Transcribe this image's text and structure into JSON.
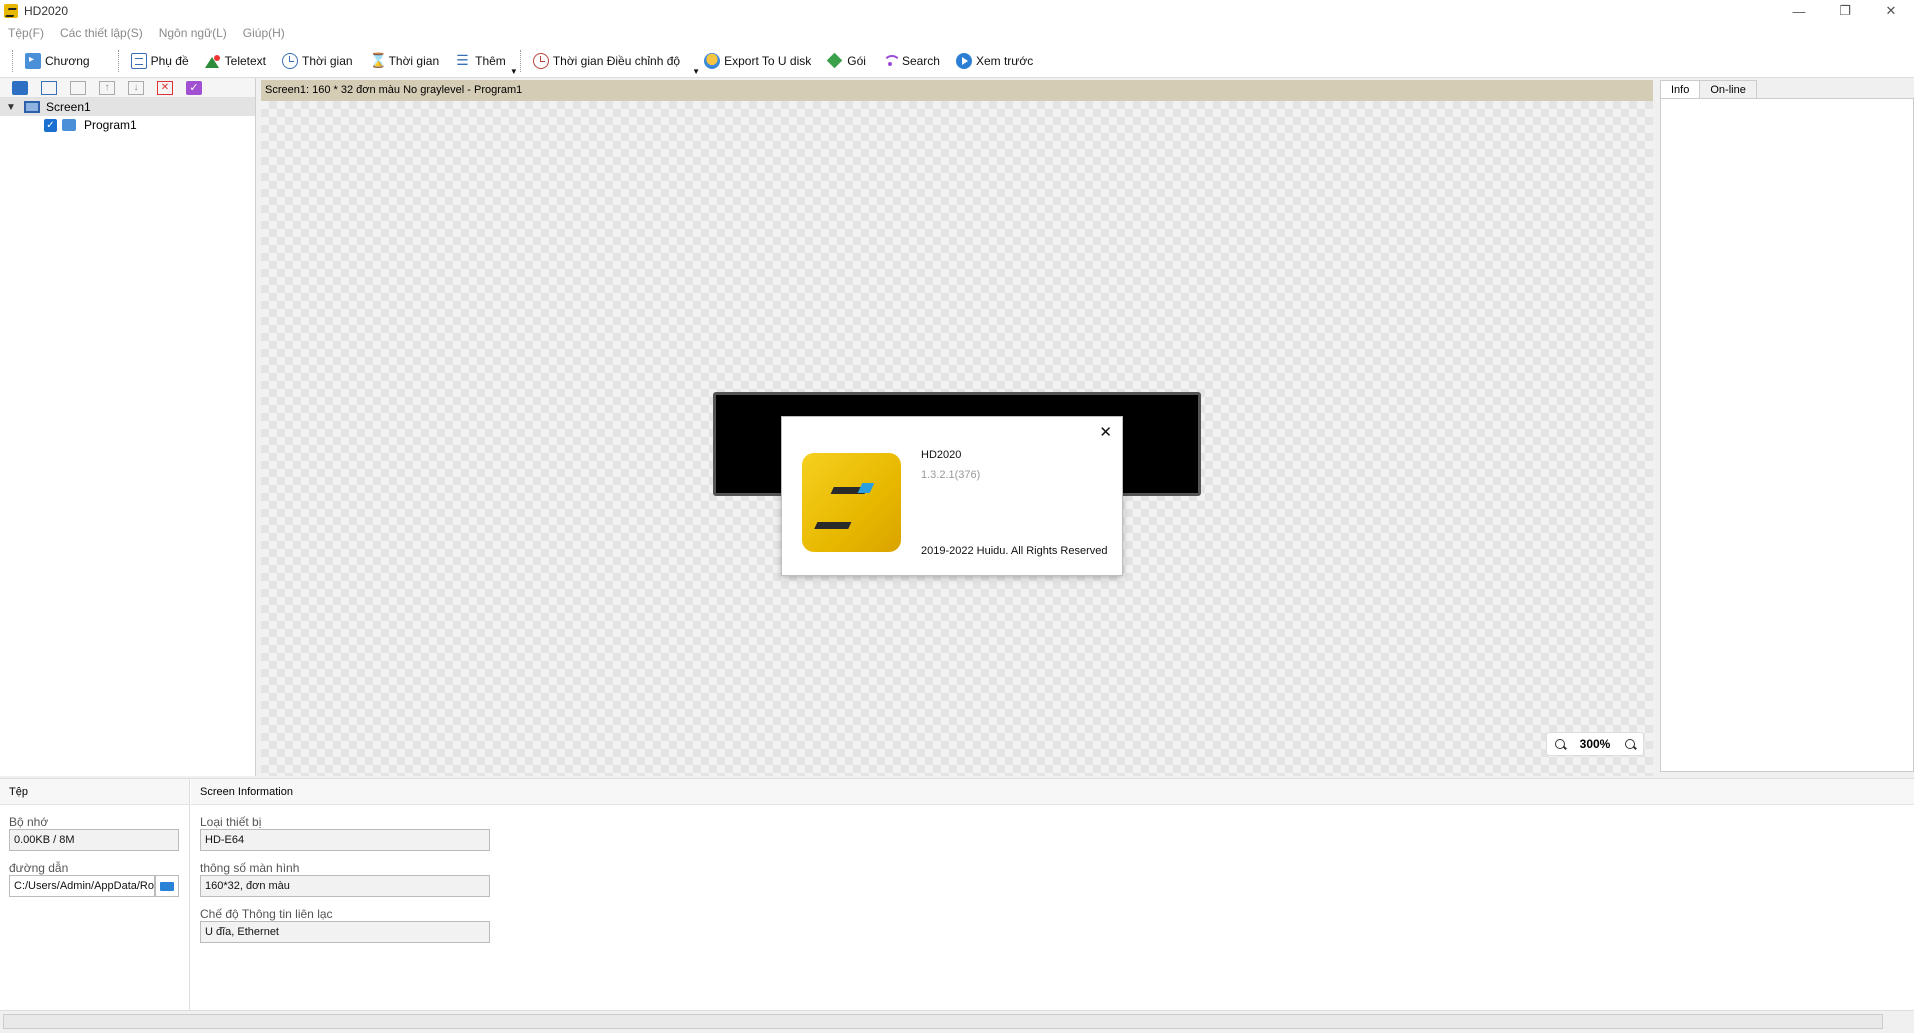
{
  "window": {
    "title": "HD2020",
    "controls": [
      "minimize",
      "restore",
      "close"
    ]
  },
  "menu": [
    "Tệp(F)",
    "Các thiết lập(S)",
    "Ngôn ngữ(L)",
    "Giúp(H)"
  ],
  "toolbar": {
    "chuong": "Chương",
    "phude": "Phụ đề",
    "teletext": "Teletext",
    "thoigian1": "Thời gian",
    "thoigian2": "Thời gian",
    "them": "Thêm",
    "adjust": "Thời gian Điều chỉnh độ",
    "export": "Export To U disk",
    "goi": "Gói",
    "search": "Search",
    "preview": "Xem trước"
  },
  "tree": {
    "screen": "Screen1",
    "program": "Program1"
  },
  "canvas": {
    "header": "Screen1: 160 * 32 đơn màu No graylevel - Program1",
    "zoom": "300%"
  },
  "right_panel": {
    "tabs": [
      "Info",
      "On-line"
    ]
  },
  "file_section": {
    "title": "Tệp",
    "memory_label": "Bộ nhớ",
    "memory_value": "0.00KB / 8M",
    "path_label": "đường dẫn",
    "path_value": "C:/Users/Admin/AppData/Roa"
  },
  "screen_info": {
    "title": "Screen Information",
    "device_label": "Loại thiết bị",
    "device_value": "HD-E64",
    "spec_label": "thông số màn hình",
    "spec_value": "160*32, đơn màu",
    "comm_label": "Chế độ Thông tin liên lạc",
    "comm_value": "U đĩa, Ethernet"
  },
  "about": {
    "name": "HD2020",
    "version": "1.3.2.1(376)",
    "copyright": "2019-2022 Huidu. All Rights Reserved",
    "close": "✕"
  },
  "colors": {
    "canvas_header_bg": "#d5ccb5",
    "logo_yellow": "#e8b800",
    "accent_blue": "#1a6fd1"
  }
}
